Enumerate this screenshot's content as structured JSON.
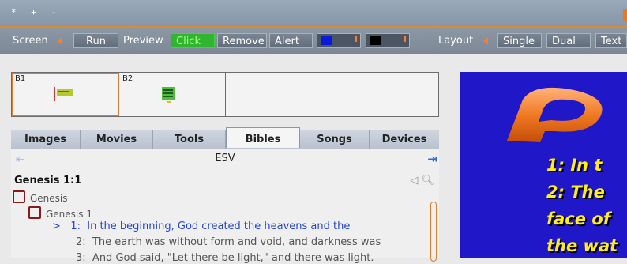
{
  "titlebar": {
    "controls": "* + -"
  },
  "toolbar": {
    "screen_label": "Screen",
    "run": "Run",
    "preview": "Preview",
    "click": "Click",
    "remove": "Remove",
    "alert": "Alert",
    "layout_label": "Layout",
    "single": "Single",
    "dual": "Dual",
    "text": "Text",
    "swatch_colors": [
      "#0a1ad8",
      "#000000"
    ]
  },
  "thumbs": [
    {
      "label": "B1",
      "selected": true
    },
    {
      "label": "B2",
      "selected": false
    },
    {
      "label": "",
      "selected": false
    },
    {
      "label": "",
      "selected": false
    }
  ],
  "tabs": [
    "Images",
    "Movies",
    "Tools",
    "Bibles",
    "Songs",
    "Devices"
  ],
  "active_tab": "Bibles",
  "bible": {
    "version": "ESV",
    "reference": "Genesis 1:1",
    "book": "Genesis",
    "chapter": "Genesis 1",
    "verses": [
      {
        "marker": ">",
        "num": "1:",
        "text": "In the beginning, God created the heavens and the",
        "selected": true
      },
      {
        "marker": "",
        "num": "2:",
        "text": "The earth was without form and void, and darkness was",
        "selected": false
      },
      {
        "marker": "",
        "num": "3:",
        "text": "And God said, \"Let there be light,\" and there was light.",
        "selected": false
      }
    ]
  },
  "preview": {
    "lines": [
      "1:  In t",
      "2:  The",
      "face of",
      "the wat"
    ],
    "background": "#1f17c8",
    "text_color": "#ffec1a"
  }
}
